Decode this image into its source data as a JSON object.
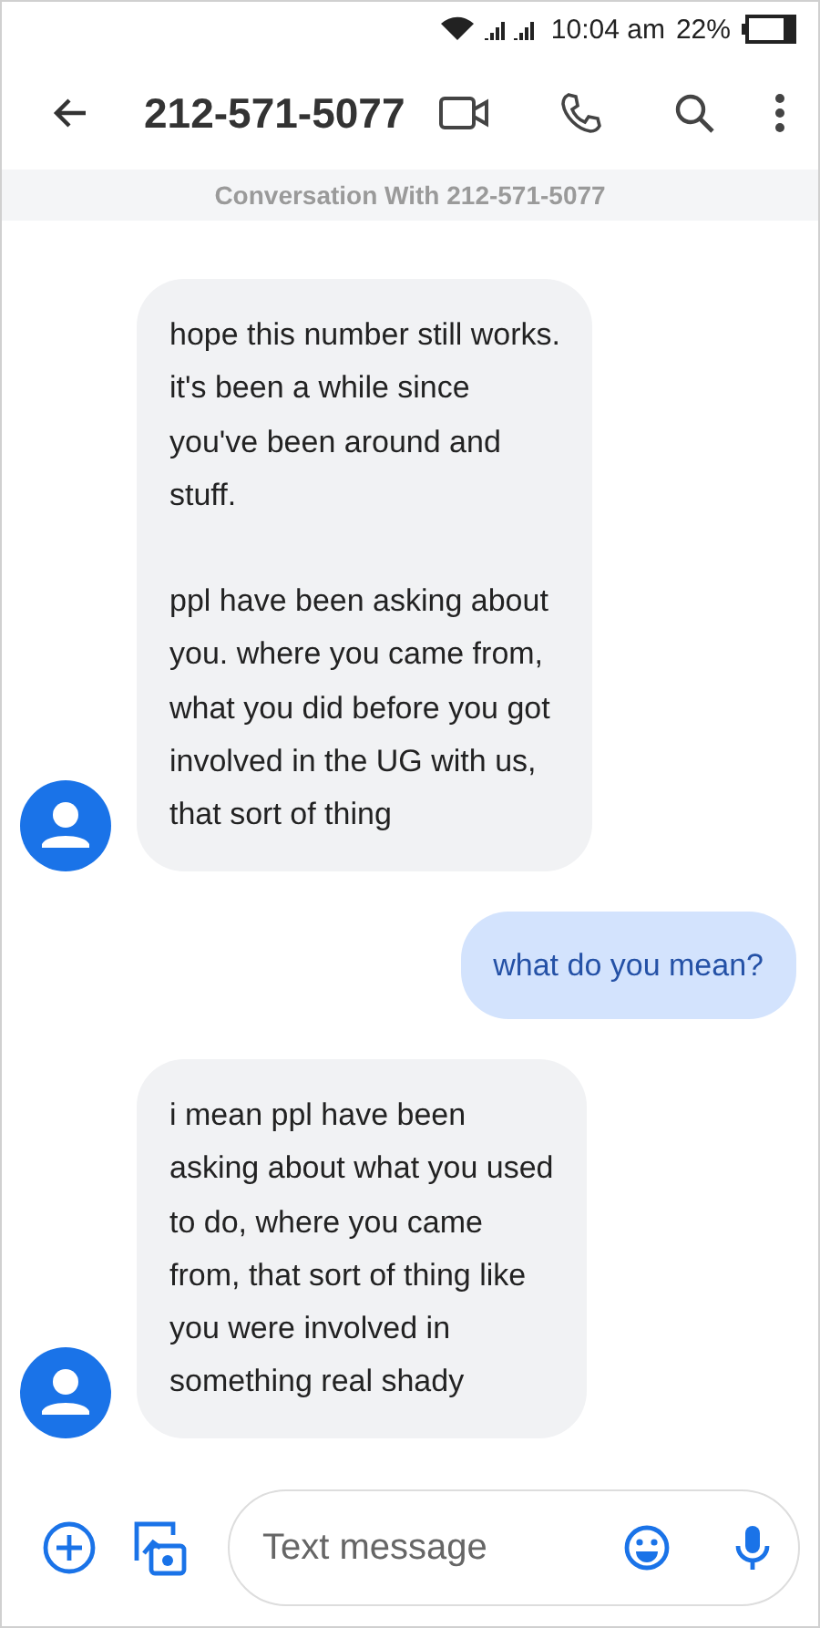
{
  "status_bar": {
    "time": "10:04 am",
    "battery_text": "22%"
  },
  "header": {
    "title": "212-571-5077"
  },
  "banner": "Conversation With 212-571-5077",
  "messages": [
    {
      "kind": "incoming",
      "paragraphs": [
        "hope this number still works.\nit's been a while since\nyou've been around and\nstuff.",
        "ppl have been asking about\nyou. where you came from,\nwhat you did before you got\ninvolved in the UG with us,\nthat sort of thing"
      ]
    },
    {
      "kind": "outgoing",
      "paragraphs": [
        "what do you mean?"
      ]
    },
    {
      "kind": "incoming",
      "paragraphs": [
        "i mean ppl have been\nasking about what you used\nto do, where you came\nfrom, that sort of thing like\nyou were involved in\nsomething real shady"
      ]
    }
  ],
  "composer": {
    "placeholder": "Text message"
  }
}
